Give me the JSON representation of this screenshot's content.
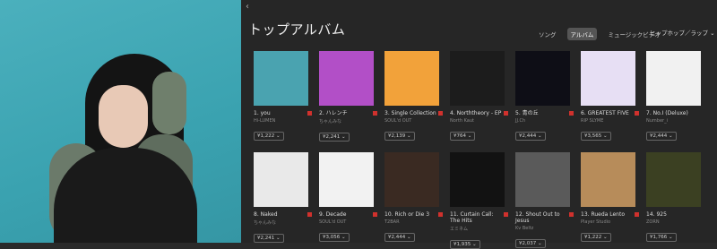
{
  "store": {
    "back_icon": "chevron-left-icon",
    "title": "トップアルバム",
    "filters": [
      {
        "label": "ソング",
        "active": false
      },
      {
        "label": "アルバム",
        "active": true
      },
      {
        "label": "ミュージックビデオ",
        "active": false
      }
    ],
    "genre_label": "ヒップホップ／ラップ ⌄",
    "row1": [
      {
        "name": "1. you",
        "artist": "Hi-LUMEN",
        "price": "¥1,222 ⌄",
        "color": "#4aa3b0",
        "explicit": true
      },
      {
        "name": "2. ハレンチ",
        "artist": "ちゃんみな",
        "price": "¥2,241 ⌄",
        "color": "#b24fc7",
        "explicit": true
      },
      {
        "name": "3. Single Collection",
        "artist": "SOUL'd OUT",
        "price": "¥2,139 ⌄",
        "color": "#f2a23a",
        "explicit": true
      },
      {
        "name": "4. Norththeory - EP",
        "artist": "North Kaut",
        "price": "¥764 ⌄",
        "color": "#1c1c1c",
        "explicit": true
      },
      {
        "name": "5. 青の丘",
        "artist": "JJ.Ch",
        "price": "¥2,444 ⌄",
        "color": "#0e0e16",
        "explicit": true
      },
      {
        "name": "6. GREATEST FIVE",
        "artist": "RIP SLYME",
        "price": "¥3,565 ⌄",
        "color": "#e7dff4",
        "explicit": true
      },
      {
        "name": "7. No.I (Deluxe)",
        "artist": "Number_i",
        "price": "¥2,444 ⌄",
        "color": "#f1f1f1",
        "explicit": false
      }
    ],
    "row2": [
      {
        "name": "8. Naked",
        "artist": "ちゃんみな",
        "price": "¥2,241 ⌄",
        "color": "#e9e9e9",
        "explicit": true
      },
      {
        "name": "9. Decade",
        "artist": "SOUL'd OUT",
        "price": "¥3,056 ⌄",
        "color": "#f2f2f2",
        "explicit": true
      },
      {
        "name": "10. Rich or Die 3",
        "artist": "T2BAR",
        "price": "¥2,444 ⌄",
        "color": "#3a2a22",
        "explicit": true
      },
      {
        "name": "11. Curtain Call: The Hits",
        "artist": "エミネム",
        "price": "¥1,935 ⌄",
        "color": "#121212",
        "explicit": true
      },
      {
        "name": "12. Shout Out to Jesus",
        "artist": "Kv Beltz",
        "price": "¥2,037 ⌄",
        "color": "#5a5a5a",
        "explicit": true
      },
      {
        "name": "13. Rueda Lento",
        "artist": "Player Studio",
        "price": "¥1,222 ⌄",
        "color": "#b78c5a",
        "explicit": true
      },
      {
        "name": "14. 925",
        "artist": "ZORN",
        "price": "¥1,766 ⌄",
        "color": "#3b4022",
        "explicit": false
      }
    ]
  }
}
